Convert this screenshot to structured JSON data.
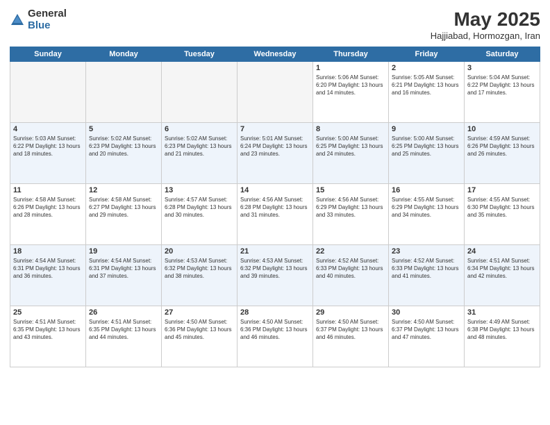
{
  "logo": {
    "general": "General",
    "blue": "Blue"
  },
  "title": {
    "month_year": "May 2025",
    "location": "Hajjiabad, Hormozgan, Iran"
  },
  "days_of_week": [
    "Sunday",
    "Monday",
    "Tuesday",
    "Wednesday",
    "Thursday",
    "Friday",
    "Saturday"
  ],
  "weeks": [
    {
      "row_class": "",
      "days": [
        {
          "number": "",
          "info": ""
        },
        {
          "number": "",
          "info": ""
        },
        {
          "number": "",
          "info": ""
        },
        {
          "number": "",
          "info": ""
        },
        {
          "number": "1",
          "info": "Sunrise: 5:06 AM\nSunset: 6:20 PM\nDaylight: 13 hours\nand 14 minutes."
        },
        {
          "number": "2",
          "info": "Sunrise: 5:05 AM\nSunset: 6:21 PM\nDaylight: 13 hours\nand 16 minutes."
        },
        {
          "number": "3",
          "info": "Sunrise: 5:04 AM\nSunset: 6:22 PM\nDaylight: 13 hours\nand 17 minutes."
        }
      ]
    },
    {
      "row_class": "row-even",
      "days": [
        {
          "number": "4",
          "info": "Sunrise: 5:03 AM\nSunset: 6:22 PM\nDaylight: 13 hours\nand 18 minutes."
        },
        {
          "number": "5",
          "info": "Sunrise: 5:02 AM\nSunset: 6:23 PM\nDaylight: 13 hours\nand 20 minutes."
        },
        {
          "number": "6",
          "info": "Sunrise: 5:02 AM\nSunset: 6:23 PM\nDaylight: 13 hours\nand 21 minutes."
        },
        {
          "number": "7",
          "info": "Sunrise: 5:01 AM\nSunset: 6:24 PM\nDaylight: 13 hours\nand 23 minutes."
        },
        {
          "number": "8",
          "info": "Sunrise: 5:00 AM\nSunset: 6:25 PM\nDaylight: 13 hours\nand 24 minutes."
        },
        {
          "number": "9",
          "info": "Sunrise: 5:00 AM\nSunset: 6:25 PM\nDaylight: 13 hours\nand 25 minutes."
        },
        {
          "number": "10",
          "info": "Sunrise: 4:59 AM\nSunset: 6:26 PM\nDaylight: 13 hours\nand 26 minutes."
        }
      ]
    },
    {
      "row_class": "",
      "days": [
        {
          "number": "11",
          "info": "Sunrise: 4:58 AM\nSunset: 6:26 PM\nDaylight: 13 hours\nand 28 minutes."
        },
        {
          "number": "12",
          "info": "Sunrise: 4:58 AM\nSunset: 6:27 PM\nDaylight: 13 hours\nand 29 minutes."
        },
        {
          "number": "13",
          "info": "Sunrise: 4:57 AM\nSunset: 6:28 PM\nDaylight: 13 hours\nand 30 minutes."
        },
        {
          "number": "14",
          "info": "Sunrise: 4:56 AM\nSunset: 6:28 PM\nDaylight: 13 hours\nand 31 minutes."
        },
        {
          "number": "15",
          "info": "Sunrise: 4:56 AM\nSunset: 6:29 PM\nDaylight: 13 hours\nand 33 minutes."
        },
        {
          "number": "16",
          "info": "Sunrise: 4:55 AM\nSunset: 6:29 PM\nDaylight: 13 hours\nand 34 minutes."
        },
        {
          "number": "17",
          "info": "Sunrise: 4:55 AM\nSunset: 6:30 PM\nDaylight: 13 hours\nand 35 minutes."
        }
      ]
    },
    {
      "row_class": "row-even",
      "days": [
        {
          "number": "18",
          "info": "Sunrise: 4:54 AM\nSunset: 6:31 PM\nDaylight: 13 hours\nand 36 minutes."
        },
        {
          "number": "19",
          "info": "Sunrise: 4:54 AM\nSunset: 6:31 PM\nDaylight: 13 hours\nand 37 minutes."
        },
        {
          "number": "20",
          "info": "Sunrise: 4:53 AM\nSunset: 6:32 PM\nDaylight: 13 hours\nand 38 minutes."
        },
        {
          "number": "21",
          "info": "Sunrise: 4:53 AM\nSunset: 6:32 PM\nDaylight: 13 hours\nand 39 minutes."
        },
        {
          "number": "22",
          "info": "Sunrise: 4:52 AM\nSunset: 6:33 PM\nDaylight: 13 hours\nand 40 minutes."
        },
        {
          "number": "23",
          "info": "Sunrise: 4:52 AM\nSunset: 6:33 PM\nDaylight: 13 hours\nand 41 minutes."
        },
        {
          "number": "24",
          "info": "Sunrise: 4:51 AM\nSunset: 6:34 PM\nDaylight: 13 hours\nand 42 minutes."
        }
      ]
    },
    {
      "row_class": "",
      "days": [
        {
          "number": "25",
          "info": "Sunrise: 4:51 AM\nSunset: 6:35 PM\nDaylight: 13 hours\nand 43 minutes."
        },
        {
          "number": "26",
          "info": "Sunrise: 4:51 AM\nSunset: 6:35 PM\nDaylight: 13 hours\nand 44 minutes."
        },
        {
          "number": "27",
          "info": "Sunrise: 4:50 AM\nSunset: 6:36 PM\nDaylight: 13 hours\nand 45 minutes."
        },
        {
          "number": "28",
          "info": "Sunrise: 4:50 AM\nSunset: 6:36 PM\nDaylight: 13 hours\nand 46 minutes."
        },
        {
          "number": "29",
          "info": "Sunrise: 4:50 AM\nSunset: 6:37 PM\nDaylight: 13 hours\nand 46 minutes."
        },
        {
          "number": "30",
          "info": "Sunrise: 4:50 AM\nSunset: 6:37 PM\nDaylight: 13 hours\nand 47 minutes."
        },
        {
          "number": "31",
          "info": "Sunrise: 4:49 AM\nSunset: 6:38 PM\nDaylight: 13 hours\nand 48 minutes."
        }
      ]
    }
  ]
}
